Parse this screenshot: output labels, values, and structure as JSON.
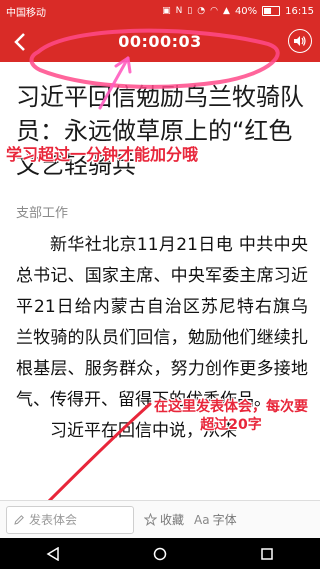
{
  "status_bar": {
    "carrier": "中国移动",
    "battery": "40%",
    "battery_level": 0.4,
    "time": "16:15"
  },
  "header": {
    "timer": "00:00:03"
  },
  "article": {
    "title": "习近平回信勉励乌兰牧骑队员：永远做草原上的“红色文艺轻骑兵”",
    "category": "支部工作",
    "paragraphs": [
      "新华社北京11月21日电 中共中央总书记、国家主席、中央军委主席习近平21日给内蒙古自治区苏尼特右旗乌兰牧骑的队员们回信，勉励他们继续扎根基层、服务群众，努力创作更多接地气、传得开、留得下的优秀作品。",
      "习近平在回信中说，从来"
    ]
  },
  "annotations": {
    "note_top": "学习超过一分钟才能加分哦",
    "note_bottom": "在这里发表体会，每次要超过20字"
  },
  "toolbar": {
    "comment_placeholder": "发表体会",
    "favorite_label": "收藏",
    "font_label": "字体"
  },
  "colors": {
    "brand_red": "#d92b27",
    "annotation_red": "#e8263a"
  }
}
